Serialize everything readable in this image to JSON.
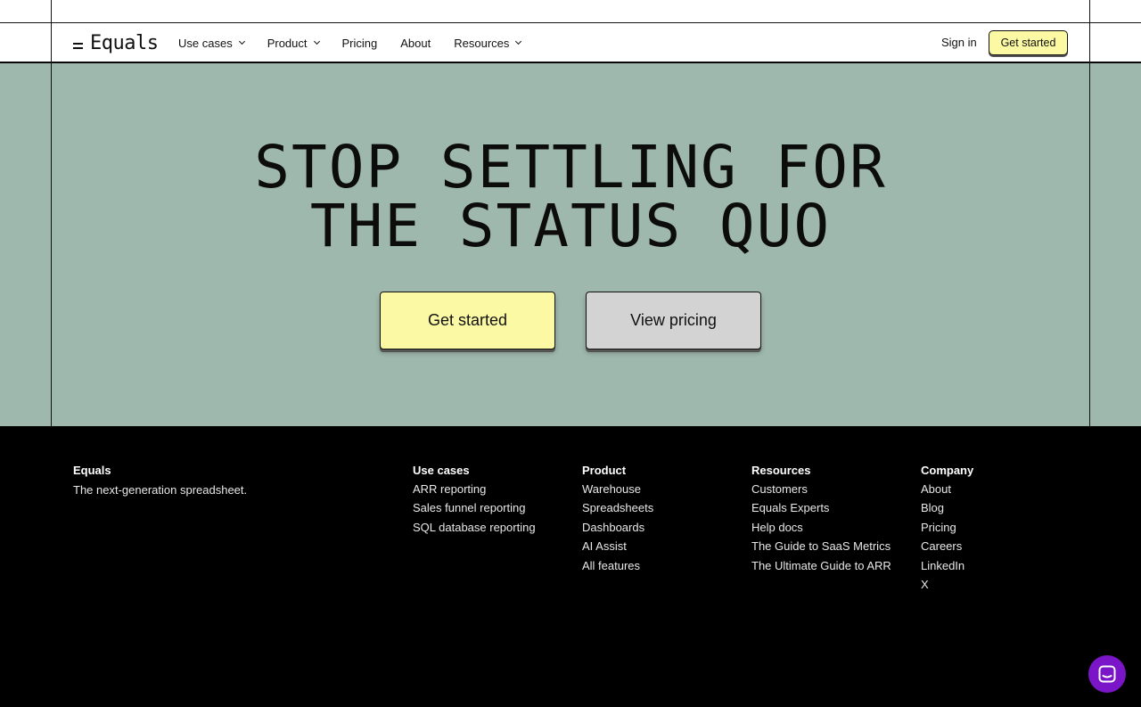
{
  "brand": {
    "name": "Equals"
  },
  "nav": {
    "items": [
      {
        "label": "Use cases",
        "dropdown": true
      },
      {
        "label": "Product",
        "dropdown": true
      },
      {
        "label": "Pricing",
        "dropdown": false
      },
      {
        "label": "About",
        "dropdown": false
      },
      {
        "label": "Resources",
        "dropdown": true
      }
    ],
    "sign_in": "Sign in",
    "cta": "Get started"
  },
  "hero": {
    "line1": "STOP SETTLING FOR",
    "line2": "THE STATUS QUO",
    "primary_cta": "Get started",
    "secondary_cta": "View pricing",
    "bg_color": "#9fb8ad",
    "primary_color": "#fbf9a4",
    "secondary_color": "#d3d3d3"
  },
  "footer": {
    "brand": {
      "title": "Equals",
      "tagline": "The next-generation spreadsheet."
    },
    "columns": [
      {
        "title": "Use cases",
        "links": [
          "ARR reporting",
          "Sales funnel reporting",
          "SQL database reporting"
        ]
      },
      {
        "title": "Product",
        "links": [
          "Warehouse",
          "Spreadsheets",
          "Dashboards",
          "AI Assist",
          "All features"
        ]
      },
      {
        "title": "Resources",
        "links": [
          "Customers",
          "Equals Experts",
          "Help docs",
          "The Guide to SaaS Metrics",
          "The Ultimate Guide to ARR"
        ]
      },
      {
        "title": "Company",
        "links": [
          "About",
          "Blog",
          "Pricing",
          "Careers",
          "LinkedIn",
          "X"
        ]
      }
    ]
  },
  "chat": {
    "icon": "chat-icon",
    "color": "#7a16c7"
  }
}
